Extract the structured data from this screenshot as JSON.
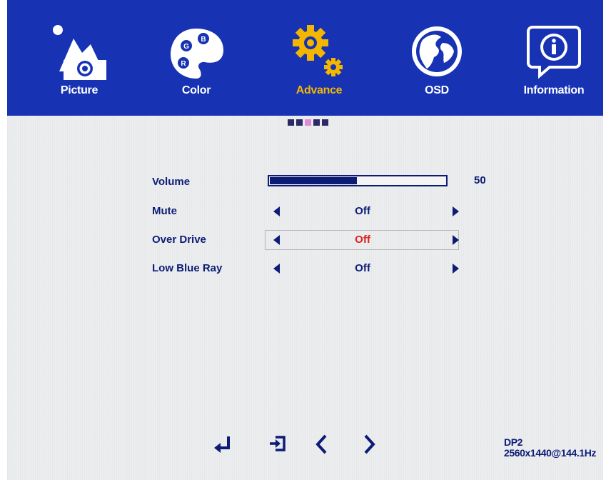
{
  "tabs": [
    {
      "label": "Picture",
      "icon": "picture-icon"
    },
    {
      "label": "Color",
      "icon": "palette-icon"
    },
    {
      "label": "Advance",
      "icon": "gears-icon",
      "active": true
    },
    {
      "label": "OSD",
      "icon": "globe-icon"
    },
    {
      "label": "Information",
      "icon": "info-icon"
    }
  ],
  "palette_letters": {
    "g": "G",
    "b": "B",
    "r": "R"
  },
  "settings": {
    "volume": {
      "label": "Volume",
      "value": "50",
      "level": 0.5
    },
    "mute": {
      "label": "Mute",
      "value": "Off"
    },
    "over_drive": {
      "label": "Over Drive",
      "value": "Off",
      "selected": true
    },
    "low_blue_ray": {
      "label": "Low Blue Ray",
      "value": "Off"
    }
  },
  "footer": {
    "nav_icons": [
      "enter-icon",
      "exit-icon",
      "left-icon",
      "right-icon"
    ]
  },
  "status": {
    "input": "DP2",
    "mode": "2560x1440@144.1Hz"
  },
  "colors": {
    "header_bg": "#1733b4",
    "text": "#0c1c76",
    "active_tab": "#f3b700",
    "selected_value": "#e0221c"
  }
}
